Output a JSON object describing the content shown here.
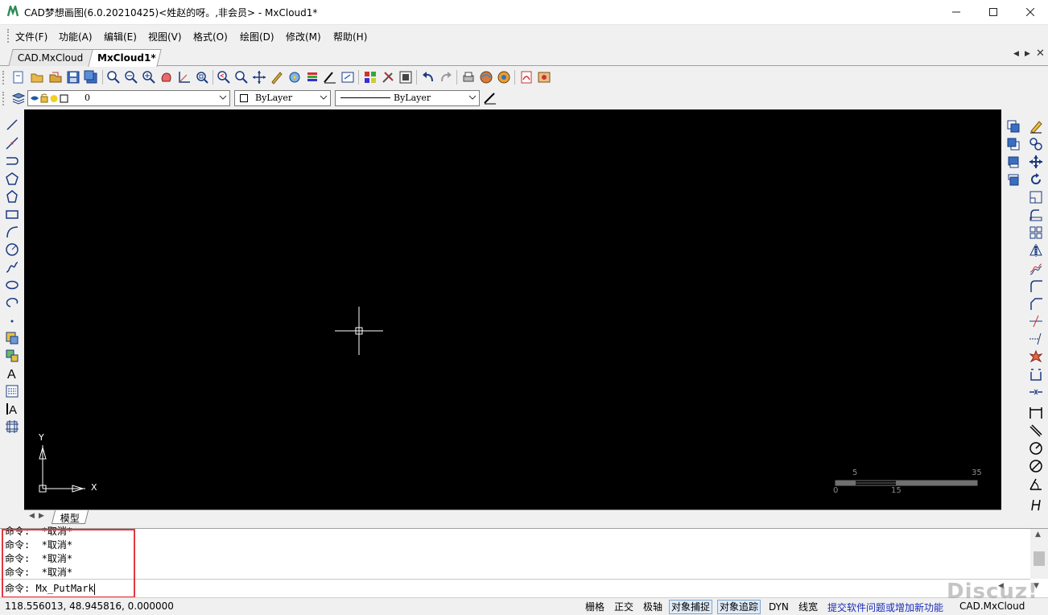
{
  "window": {
    "title": "CAD梦想画图(6.0.20210425)<姓赵的呀。,非会员> - MxCloud1*",
    "minimize_icon": "minimize-icon",
    "maximize_icon": "maximize-icon",
    "close_icon": "close-icon"
  },
  "menu": [
    {
      "label": "文件(F)"
    },
    {
      "label": "功能(A)"
    },
    {
      "label": "编辑(E)"
    },
    {
      "label": "视图(V)"
    },
    {
      "label": "格式(O)"
    },
    {
      "label": "绘图(D)"
    },
    {
      "label": "修改(M)"
    },
    {
      "label": "帮助(H)"
    }
  ],
  "doc_tabs": [
    {
      "label": "CAD.MxCloud"
    },
    {
      "label": "MxCloud1*",
      "active": true
    }
  ],
  "layer_bar": {
    "layer_value": "0",
    "color_value": "ByLayer",
    "linetype_value": "ByLayer"
  },
  "canvas": {
    "background": "#000000",
    "ucs_y_label": "Y",
    "ucs_x_label": "X",
    "scale_labels_top": [
      "5",
      "35"
    ],
    "scale_labels_bottom": [
      "0",
      "15"
    ]
  },
  "layout_tabs": [
    {
      "label": "模型"
    }
  ],
  "command_history": [
    "命令:  *取消*",
    "命令:  *取消*",
    "命令:  *取消*",
    "命令:  *取消*"
  ],
  "command_input": {
    "prompt": "命令:",
    "value": "Mx_PutMark"
  },
  "status": {
    "coordinates": "118.556013,  48.945816,  0.000000",
    "toggles": [
      {
        "label": "栅格",
        "on": false
      },
      {
        "label": "正交",
        "on": false
      },
      {
        "label": "极轴",
        "on": false
      },
      {
        "label": "对象捕捉",
        "on": true
      },
      {
        "label": "对象追踪",
        "on": true
      },
      {
        "label": "DYN",
        "on": false
      },
      {
        "label": "线宽",
        "on": false
      }
    ],
    "feedback_link": "提交软件问题或增加新功能",
    "brand": "CAD.MxCloud"
  },
  "watermark": "Discuz!",
  "colors": {
    "highlight_box": "#e0393e",
    "link": "#1a2db8",
    "accent": "#2e8b57"
  }
}
